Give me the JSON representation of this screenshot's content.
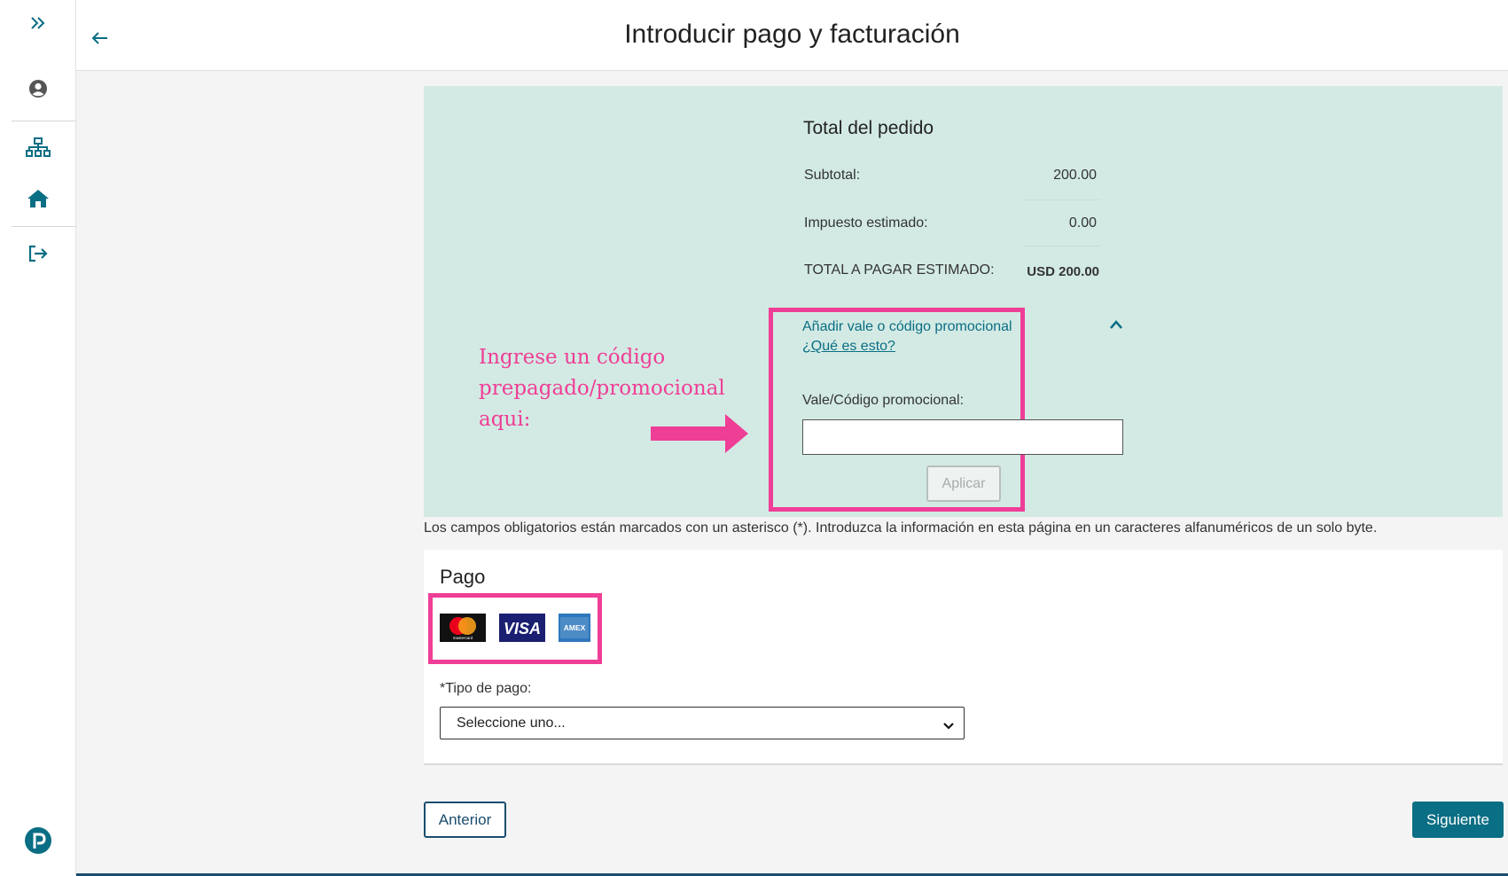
{
  "header": {
    "title": "Introducir pago y facturación",
    "back_icon": "arrow-left-icon"
  },
  "sidebar": {
    "items": [
      {
        "icon": "expand-chevrons-icon"
      },
      {
        "icon": "user-circle-icon"
      },
      {
        "icon": "sitemap-icon"
      },
      {
        "icon": "home-icon"
      },
      {
        "icon": "sign-out-icon"
      }
    ],
    "logo": "pearson-logo"
  },
  "order": {
    "title": "Total del pedido",
    "subtotal_label": "Subtotal:",
    "subtotal_value": "200.00",
    "tax_label": "Impuesto estimado:",
    "tax_value": "0.00",
    "total_label": "TOTAL A PAGAR ESTIMADO:",
    "total_value": "USD 200.00"
  },
  "promo": {
    "toggle_label": "Añadir vale o código promocional",
    "what_link": "¿Qué es esto?",
    "field_label": "Vale/Código promocional:",
    "field_value": "",
    "apply_label": "Aplicar"
  },
  "annotation": {
    "line1": "Ingrese un código",
    "line2": "prepagado/promocional",
    "line3": "aqui:"
  },
  "notice": "Los campos obligatorios están marcados con un asterisco (*). Introduzca la información en esta página en un caracteres alfanuméricos de un solo byte.",
  "payment": {
    "title": "Pago",
    "card_logos": [
      "mastercard",
      "VISA",
      "AMEX"
    ],
    "type_label": "*Tipo de pago:",
    "type_selected": "Seleccione uno..."
  },
  "nav": {
    "prev_label": "Anterior",
    "next_label": "Siguiente"
  },
  "colors": {
    "accent": "#0a6e84",
    "panel_bg": "#d3eae4",
    "highlight": "#ef3e96",
    "dark_blue": "#1a4d6e"
  }
}
